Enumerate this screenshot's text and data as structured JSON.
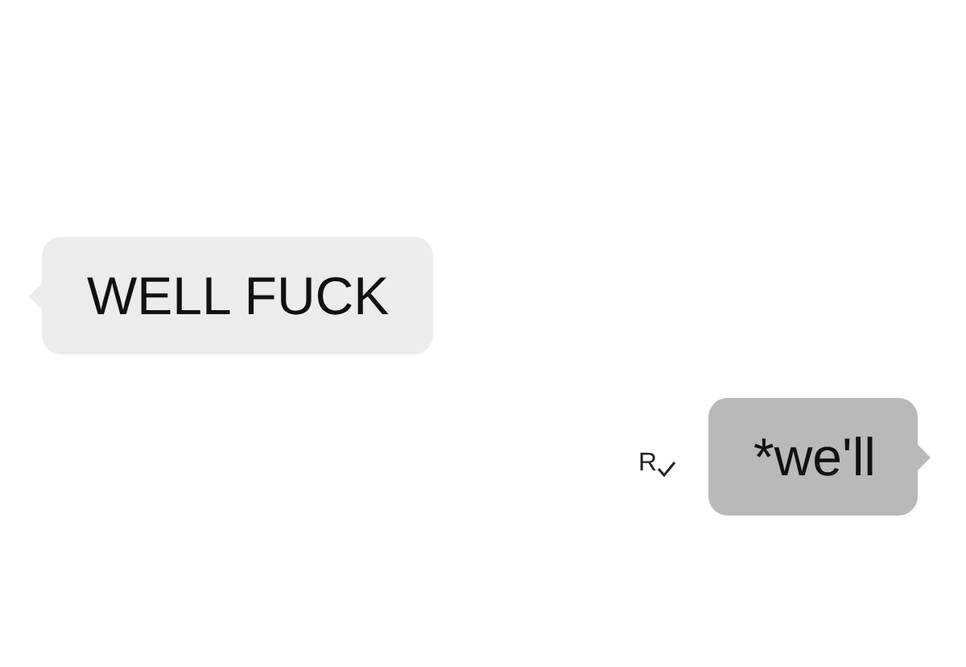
{
  "messages": [
    {
      "kind": "incoming",
      "text": "WELL FUCK"
    },
    {
      "kind": "outgoing",
      "text": "*we'll",
      "receipt": "R"
    }
  ]
}
